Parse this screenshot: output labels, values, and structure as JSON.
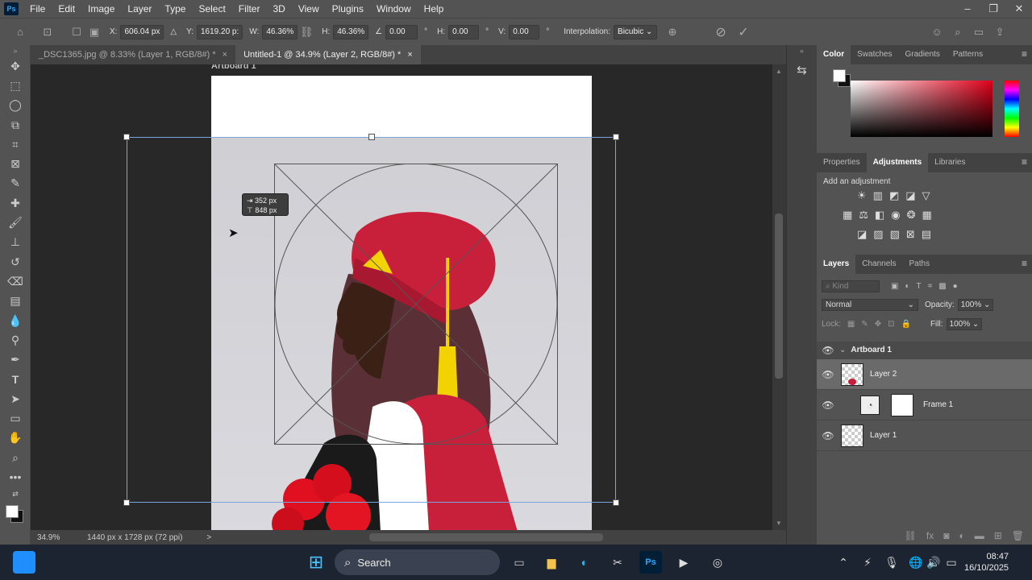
{
  "menubar": {
    "logo": "Ps",
    "items": [
      "File",
      "Edit",
      "Image",
      "Layer",
      "Type",
      "Select",
      "Filter",
      "3D",
      "View",
      "Plugins",
      "Window",
      "Help"
    ],
    "window_controls": [
      "–",
      "❐",
      "✕"
    ]
  },
  "options": {
    "x_label": "X:",
    "x_value": "606.04 px",
    "y_label": "Y:",
    "y_value": "1619.20 p:",
    "w_label": "W:",
    "w_value": "46.36%",
    "h_label": "H:",
    "h_value": "46.36%",
    "angle_value": "0.00",
    "angle_unit": "°",
    "hskew_label": "H:",
    "hskew_value": "0.00",
    "vskew_label": "V:",
    "vskew_value": "0.00",
    "interp_label": "Interpolation:",
    "interp_value": "Bicubic"
  },
  "tabs": [
    {
      "label": "_DSC1365.jpg @ 8.33% (Layer 1, RGB/8#) *",
      "close": "×"
    },
    {
      "label": "Untitled-1 @ 34.9% (Layer 2, RGB/8#) *",
      "close": "×"
    }
  ],
  "canvas": {
    "artboard_label": "Artboard 1",
    "tooltip_w": "352 px",
    "tooltip_h": "848 px"
  },
  "status": {
    "zoom": "34.9%",
    "doc_info": "1440 px x 1728 px (72 ppi)",
    "arrow": ">"
  },
  "color_panel": {
    "tabs": [
      "Color",
      "Swatches",
      "Gradients",
      "Patterns"
    ]
  },
  "adjust_panel": {
    "tabs": [
      "Properties",
      "Adjustments",
      "Libraries"
    ],
    "subtitle": "Add an adjustment"
  },
  "layers_panel": {
    "tabs": [
      "Layers",
      "Channels",
      "Paths"
    ],
    "kind_placeholder": "Kind",
    "blend_mode": "Normal",
    "opacity_label": "Opacity:",
    "opacity_value": "100%",
    "lock_label": "Lock:",
    "fill_label": "Fill:",
    "fill_value": "100%",
    "layers": [
      {
        "name": "Artboard 1",
        "type": "artboard"
      },
      {
        "name": "Layer 2",
        "type": "layer",
        "selected": true
      },
      {
        "name": "Frame 1",
        "type": "frame"
      },
      {
        "name": "Layer 1",
        "type": "layer"
      }
    ]
  },
  "taskbar": {
    "search_label": "Search",
    "time": "08:47",
    "date": "16/10/2025"
  },
  "colors": {
    "accent_blue": "#7aa5e0",
    "cap_red": "#c8203a",
    "tassel_yellow": "#f2d200",
    "ps_logo_bg": "#001e36",
    "ps_logo_fg": "#31a8ff"
  }
}
